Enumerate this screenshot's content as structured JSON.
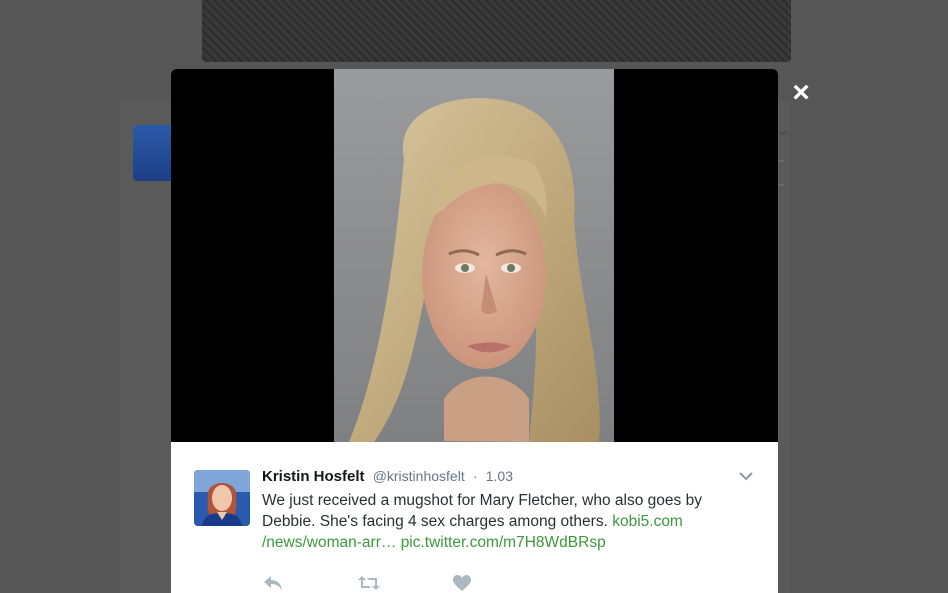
{
  "overlay": {
    "close_icon": "×"
  },
  "tweet": {
    "author_name": "Kristin Hosfelt",
    "author_handle": "@kristinhosfelt",
    "separator": "·",
    "timestamp": "1.03",
    "text_part1": "We just received a mugshot for Mary Fletcher, who also goes by Debbie. She's facing 4 sex charges among others. ",
    "link1_part1": "kobi5.com",
    "link1_part2": "/news/woman-arr…",
    "link2": "pic.twitter.com/m7H8WdBRsp",
    "actions": [
      "reply-icon",
      "retweet-icon",
      "like-icon"
    ]
  },
  "colors": {
    "link": "#3b9a3b",
    "overlay_bg": "#565656",
    "media_bg": "#000000"
  }
}
